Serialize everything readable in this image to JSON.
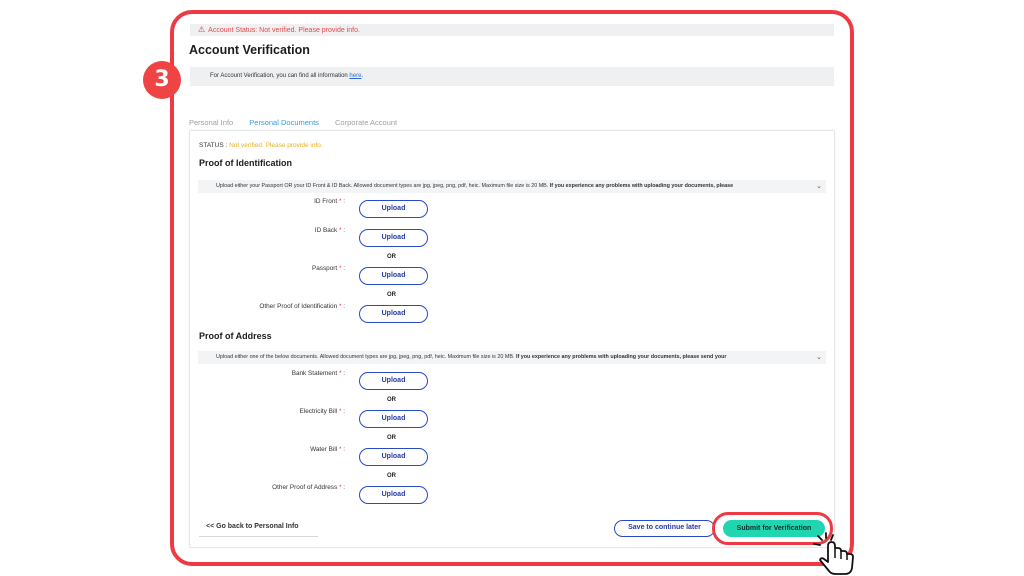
{
  "status_bar": {
    "text": "Account Status: Not verified. Please provide info."
  },
  "page": {
    "title": "Account Verification"
  },
  "step_badge": "3",
  "info_bar": {
    "text": "For Account Verification, you can find all information ",
    "link": "here",
    "end": "."
  },
  "tabs": [
    {
      "label": "Personal Info",
      "active": false
    },
    {
      "label": "Personal Documents",
      "active": true
    },
    {
      "label": "Corporate Account",
      "active": false
    }
  ],
  "status_line": {
    "label": "STATUS : ",
    "value": "Not verified. Please provide info."
  },
  "identification": {
    "title": "Proof of Identification",
    "note": "Upload either your Passport OR your ID Front & ID Back. Allowed document types are jpg, jpeg, png, pdf, heic. Maximum file size is 20 MB. ",
    "note_bold": "If you experience any problems with uploading your documents, please",
    "fields": [
      {
        "label": "ID Front",
        "req": " *",
        "button": "Upload"
      },
      {
        "label": "ID Back",
        "req": " *",
        "button": "Upload"
      },
      {
        "label": "Passport",
        "req": " *",
        "button": "Upload"
      },
      {
        "label": "Other Proof of Identification",
        "req": " *",
        "button": "Upload"
      }
    ],
    "or": "OR"
  },
  "address": {
    "title": "Proof of Address",
    "note": "Upload either one of the below documents. Allowed document types are jpg, jpeg, png, pdf, heic. Maximum file size is 20 MB. ",
    "note_bold": "If you experience any problems with uploading your documents, please send your",
    "fields": [
      {
        "label": "Bank Statement",
        "req": " *",
        "button": "Upload"
      },
      {
        "label": "Electricity Bill",
        "req": " *",
        "button": "Upload"
      },
      {
        "label": "Water Bill",
        "req": " *",
        "button": "Upload"
      },
      {
        "label": "Other Proof of Address",
        "req": " *",
        "button": "Upload"
      }
    ],
    "or": "OR"
  },
  "footer": {
    "back": "<< Go back to Personal Info",
    "save": "Save to continue later",
    "submit": "Submit for Verification"
  },
  "colors": {
    "frame": "#ee3b43",
    "accent": "#20d6b0",
    "link": "#2a49c7",
    "warning": "#e8b21a"
  }
}
